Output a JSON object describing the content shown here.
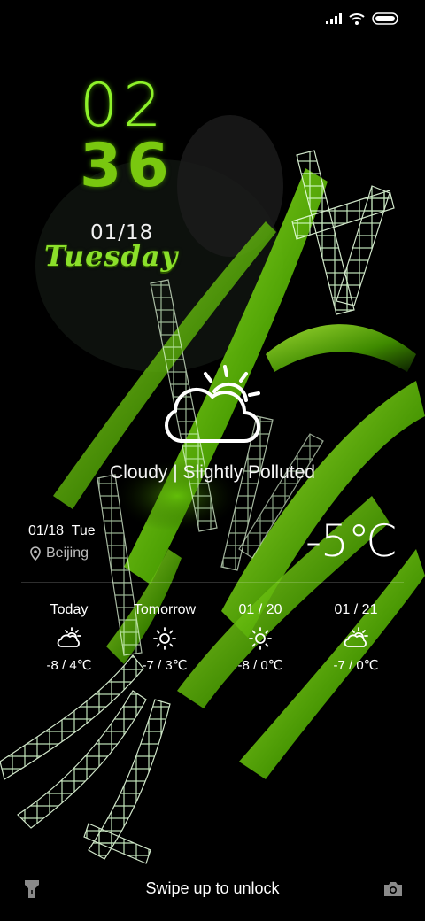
{
  "status": {
    "icons": [
      "signal-icon",
      "wifi-icon",
      "battery-icon"
    ]
  },
  "clock": {
    "hours": "02",
    "minutes": "36"
  },
  "date": {
    "short": "01/18",
    "weekday": "Tuesday"
  },
  "weather": {
    "icon": "partly-cloudy-icon",
    "description": "Cloudy | Slightly Polluted",
    "date_line": "01/18  Tue",
    "city": "Beijing",
    "temperature": "-5℃"
  },
  "forecast": [
    {
      "label": "Today",
      "icon": "partly-cloudy-icon",
      "range": "-8 / 4℃"
    },
    {
      "label": "Tomorrow",
      "icon": "sun-icon",
      "range": "-7 / 3℃"
    },
    {
      "label": "01 / 20",
      "icon": "sun-icon",
      "range": "-8 / 0℃"
    },
    {
      "label": "01 / 21",
      "icon": "partly-cloudy-icon",
      "range": "-7 / 0℃"
    }
  ],
  "footer": {
    "unlock_text": "Swipe up to unlock",
    "left_icon": "flashlight-icon",
    "right_icon": "camera-icon"
  },
  "colors": {
    "accent_green": "#8ef22a",
    "background": "#000000"
  }
}
